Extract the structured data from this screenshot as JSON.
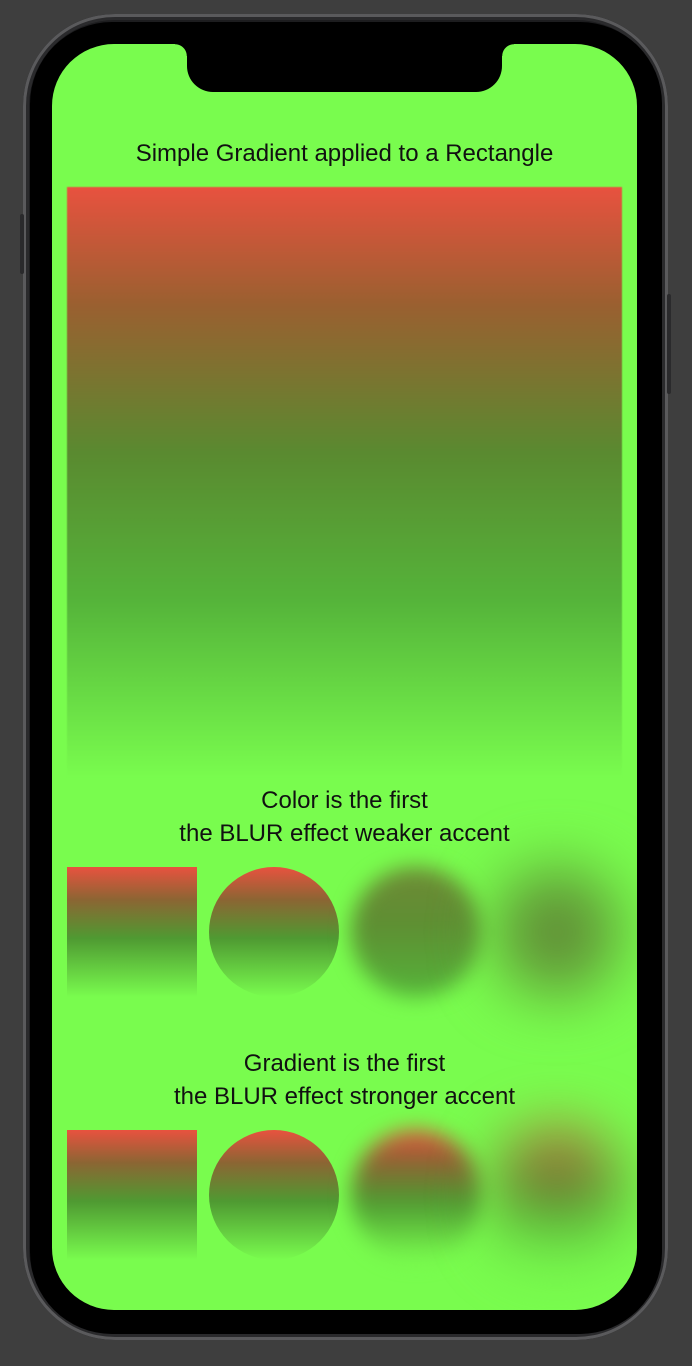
{
  "colors": {
    "screen_background": "#79fc4e",
    "gradient_top": "#e8523f",
    "gradient_bottom": "#79fc4e",
    "frame": "#1d1d1f",
    "desk": "#3e3e3e"
  },
  "section_1": {
    "title": "Simple Gradient applied to a Rectangle"
  },
  "section_2": {
    "title_line1": "Color is the first",
    "title_line2": "the BLUR effect weaker accent",
    "shapes": [
      {
        "shape": "rectangle",
        "blur": 0
      },
      {
        "shape": "circle",
        "blur": 0
      },
      {
        "shape": "circle",
        "blur": 10
      },
      {
        "shape": "circle",
        "blur": 30
      }
    ]
  },
  "section_3": {
    "title_line1": "Gradient is the first",
    "title_line2": "the BLUR effect stronger accent",
    "shapes": [
      {
        "shape": "rectangle",
        "blur": 0
      },
      {
        "shape": "circle",
        "blur": 0
      },
      {
        "shape": "circle",
        "blur": 10
      },
      {
        "shape": "circle",
        "blur": 30
      }
    ]
  }
}
